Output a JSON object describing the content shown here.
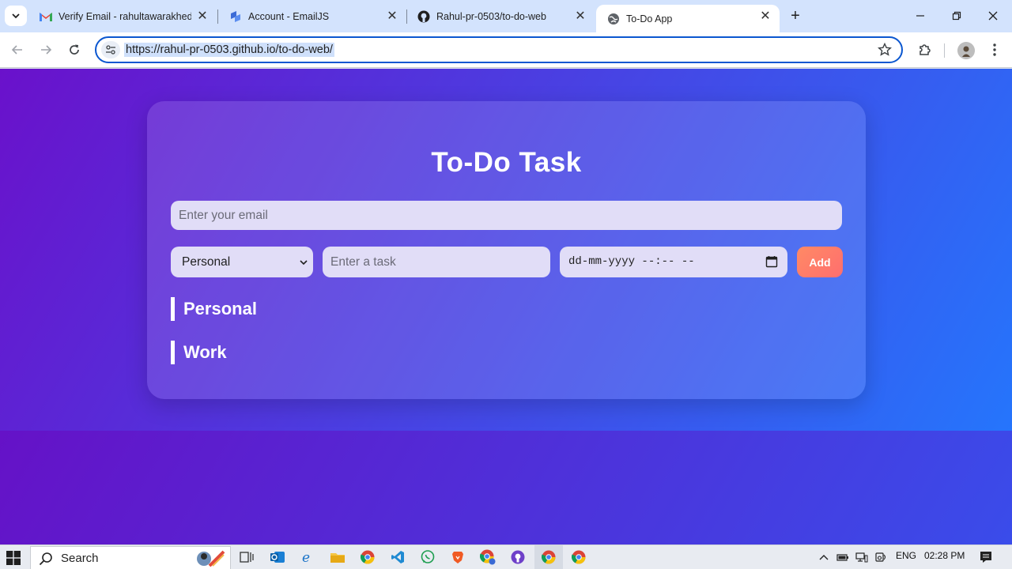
{
  "browser": {
    "tabs": [
      {
        "title": "Verify Email - rahultawarakhed",
        "favicon": "gmail-icon",
        "active": false
      },
      {
        "title": "Account - EmailJS",
        "favicon": "emailjs-icon",
        "active": false
      },
      {
        "title": "Rahul-pr-0503/to-do-web",
        "favicon": "github-icon",
        "active": false
      },
      {
        "title": "To-Do App",
        "favicon": "globe-icon",
        "active": true
      }
    ],
    "new_tab_label": "+",
    "url": "https://rahul-pr-0503.github.io/to-do-web/"
  },
  "app": {
    "title": "To-Do Task",
    "email_placeholder": "Enter your email",
    "category_selected": "Personal",
    "task_placeholder": "Enter a task",
    "date_placeholder": "dd-mm-yyyy --:-- --",
    "add_label": "Add",
    "sections": [
      "Personal",
      "Work"
    ],
    "colors": {
      "gradient_start": "#6a11cb",
      "gradient_end": "#2575fc",
      "add_button": "#ff7a6a",
      "input_bg": "#e1ddf7"
    }
  },
  "taskbar": {
    "search_label": "Search",
    "language": "ENG",
    "time": "02:28 PM",
    "apps": [
      "task-view-icon",
      "outlook-icon",
      "edge-icon",
      "file-explorer-icon",
      "chrome-icon",
      "vscode-icon",
      "whatsapp-icon",
      "brave-icon",
      "chrome-profile-icon",
      "github-desktop-icon",
      "chrome-active-icon",
      "chrome-alt-icon"
    ]
  }
}
